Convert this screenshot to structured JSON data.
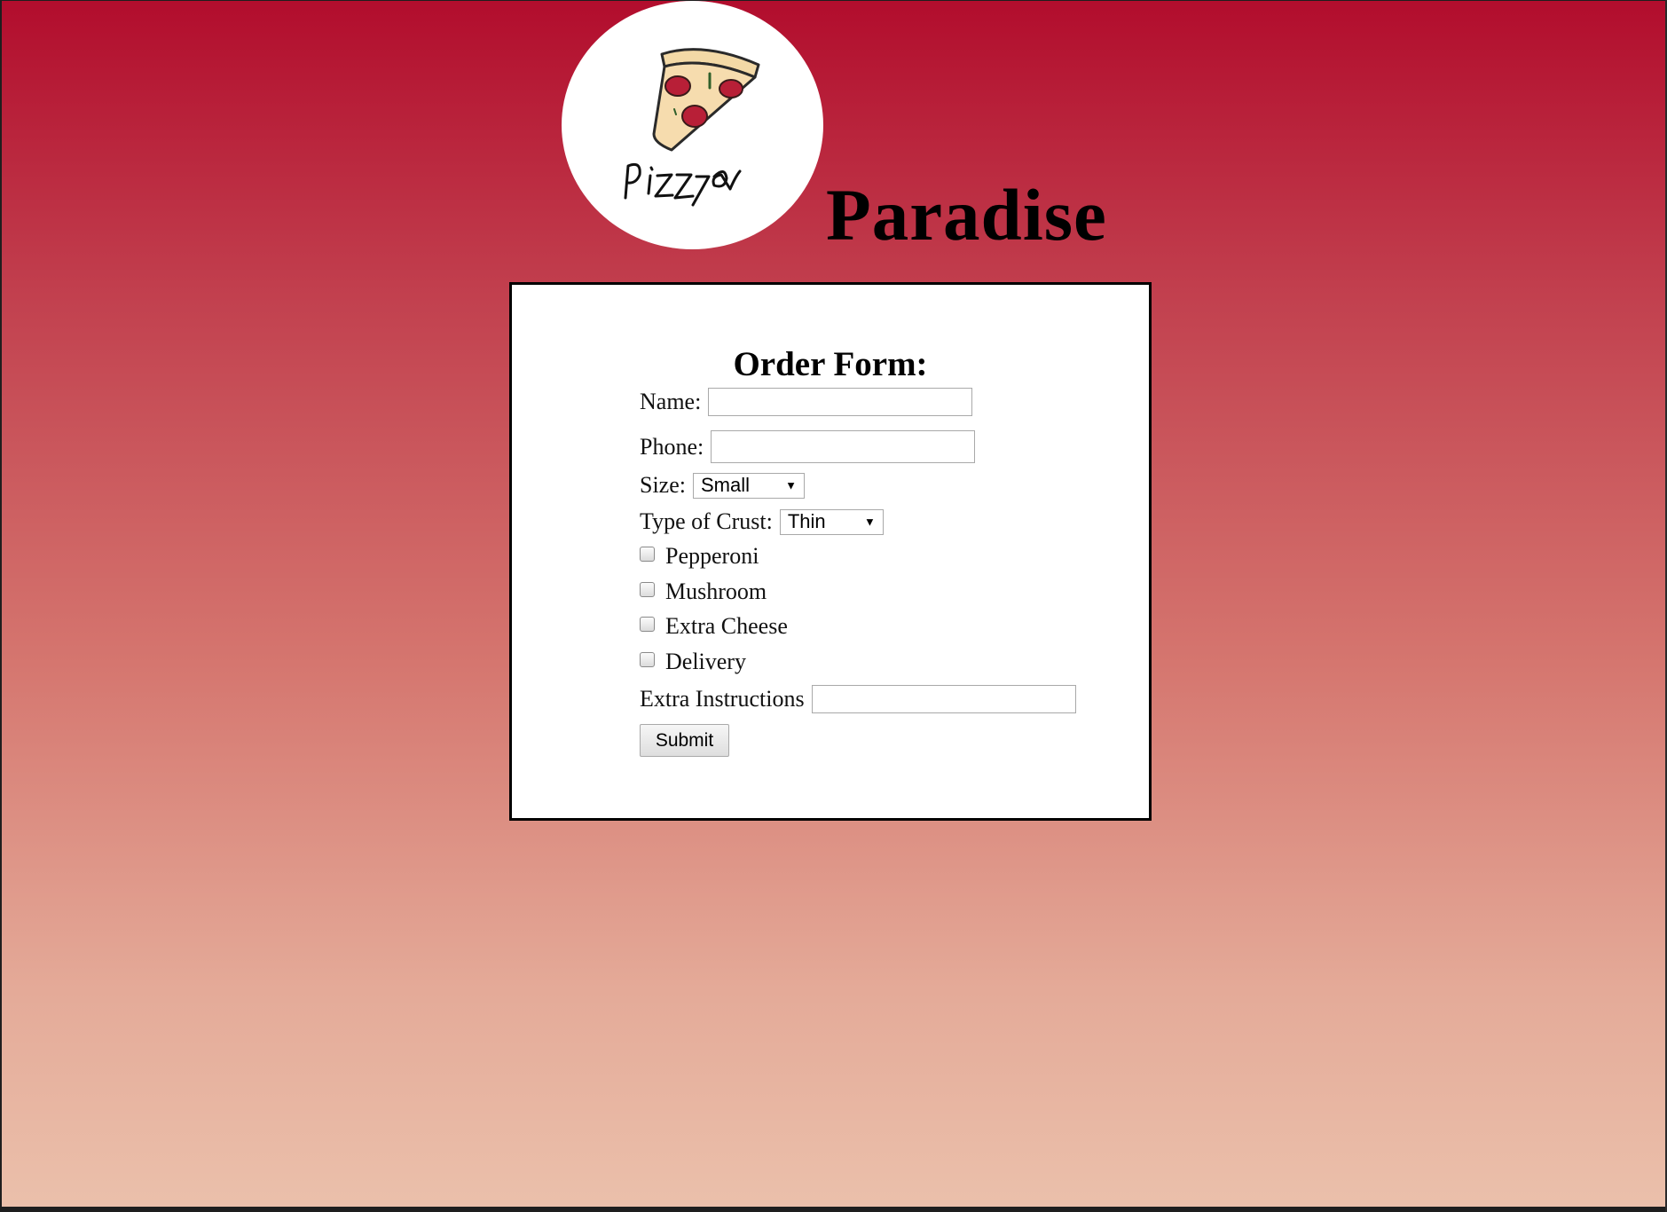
{
  "header": {
    "logo_text": "Pizza",
    "title": "Paradise"
  },
  "form": {
    "heading": "Order Form:",
    "name_label": "Name:",
    "name_value": "",
    "phone_label": "Phone:",
    "phone_value": "",
    "size_label": "Size:",
    "size_selected": "Small",
    "crust_label": "Type of Crust:",
    "crust_selected": "Thin",
    "toppings": [
      {
        "label": "Pepperoni",
        "checked": false
      },
      {
        "label": "Mushroom",
        "checked": false
      },
      {
        "label": "Extra Cheese",
        "checked": false
      },
      {
        "label": "Delivery",
        "checked": false
      }
    ],
    "instructions_label": "Extra Instructions",
    "instructions_value": "",
    "submit_label": "Submit"
  },
  "colors": {
    "gradient_top": "#b20d2d",
    "gradient_bottom": "#ebc0ab",
    "card_background": "#ffffff",
    "card_border": "#000000"
  }
}
